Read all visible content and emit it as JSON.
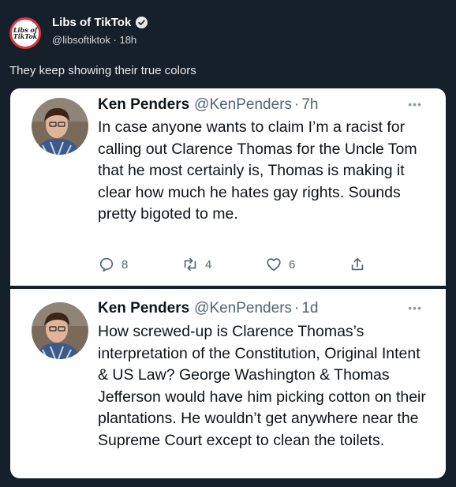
{
  "retweet": {
    "account_name": "Libs of TikTok",
    "handle": "@libsoftiktok",
    "time": "18h",
    "text": "They keep showing their true colors",
    "avatar_text_line1": "Libs of",
    "avatar_text_line2": "TikTok"
  },
  "tweets": [
    {
      "name": "Ken Penders",
      "handle": "@KenPenders",
      "time": "7h",
      "more": "•••",
      "text": "In case anyone wants to claim I’m a racist for calling out Clarence Thomas for the Uncle Tom that he most certainly is, Thomas is making it clear how much he hates gay rights. Sounds pretty bigoted to me.",
      "replies": "8",
      "retweets": "4",
      "likes": "6"
    },
    {
      "name": "Ken Penders",
      "handle": "@KenPenders",
      "time": "1d",
      "more": "•••",
      "text": "How screwed-up is Clarence Thomas’s interpretation of the Constitution, Original Intent & US Law? George Washington & Thomas Jefferson would have him picking cotton on their plantations. He wouldn’t get anywhere near the Supreme Court except to clean the toilets."
    }
  ],
  "icons": [
    "verified-badge-icon",
    "reply-icon",
    "retweet-icon",
    "like-icon",
    "share-icon",
    "more-icon"
  ],
  "colors": {
    "background": "#15202b",
    "card": "#ffffff",
    "text_dark": "#0f1419",
    "muted": "#536471",
    "avatar_ring": "#d9383f"
  }
}
